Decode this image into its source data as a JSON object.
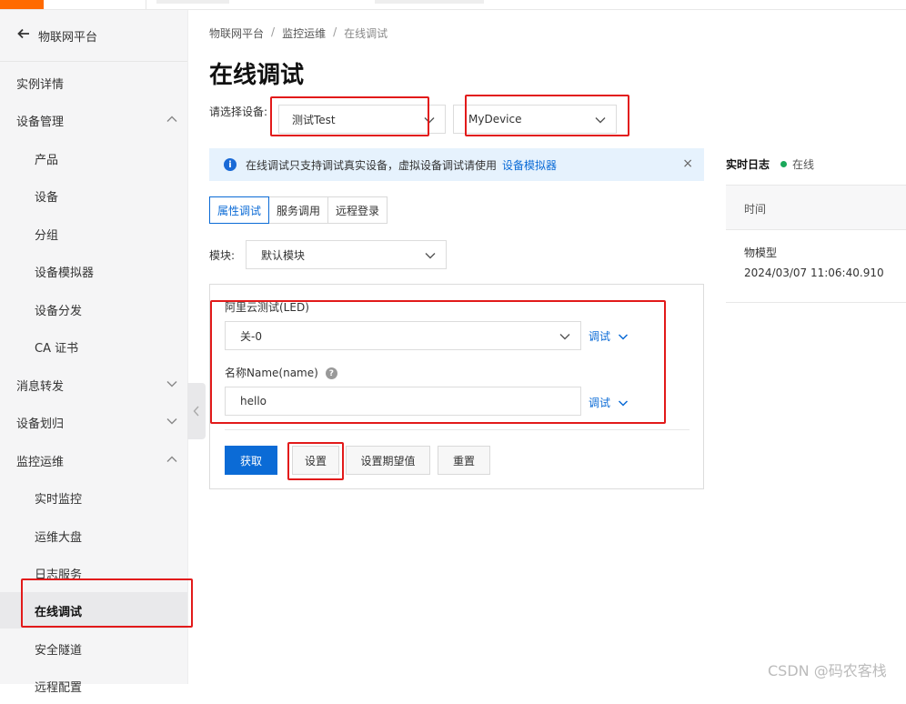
{
  "sidebar": {
    "back_label": "物联网平台",
    "items": [
      {
        "label": "实例详情"
      },
      {
        "label": "设备管理"
      },
      {
        "label": "产品"
      },
      {
        "label": "设备"
      },
      {
        "label": "分组"
      },
      {
        "label": "设备模拟器"
      },
      {
        "label": "设备分发"
      },
      {
        "label": "CA 证书"
      },
      {
        "label": "消息转发"
      },
      {
        "label": "设备划归"
      },
      {
        "label": "监控运维"
      },
      {
        "label": "实时监控"
      },
      {
        "label": "运维大盘"
      },
      {
        "label": "日志服务"
      },
      {
        "label": "在线调试"
      },
      {
        "label": "安全隧道"
      },
      {
        "label": "远程配置"
      }
    ]
  },
  "breadcrumb": {
    "items": [
      "物联网平台",
      "监控运维",
      "在线调试"
    ],
    "separator": "/"
  },
  "page_title": "在线调试",
  "device_select": {
    "label": "请选择设备:",
    "product_value": "测试Test",
    "device_value": "MyDevice"
  },
  "notice": {
    "message": "在线调试只支持调试真实设备，虚拟设备调试请使用",
    "link": "设备模拟器",
    "close": "×"
  },
  "tabs": [
    {
      "label": "属性调试",
      "active": true
    },
    {
      "label": "服务调用",
      "active": false
    },
    {
      "label": "远程登录",
      "active": false
    }
  ],
  "module": {
    "label": "模块:",
    "value": "默认模块"
  },
  "properties": [
    {
      "label": "阿里云测试(LED)",
      "value": "关-0",
      "action": "调试"
    },
    {
      "label": "名称Name(name)",
      "value": "hello",
      "action": "调试",
      "help": "?"
    }
  ],
  "buttons": {
    "get": "获取",
    "set": "设置",
    "set_expected": "设置期望值",
    "reset": "重置"
  },
  "realtime_log": {
    "title": "实时日志",
    "status": "在线",
    "column_time": "时间",
    "entries": [
      {
        "type": "物模型",
        "time": "2024/03/07 11:06:40.910"
      }
    ]
  },
  "watermark": "CSDN @码农客栈",
  "colors": {
    "primary": "#0b6bd6",
    "highlight_box": "#e21a1a",
    "online": "#1aa85a",
    "brand_accent": "#ff6a00"
  }
}
